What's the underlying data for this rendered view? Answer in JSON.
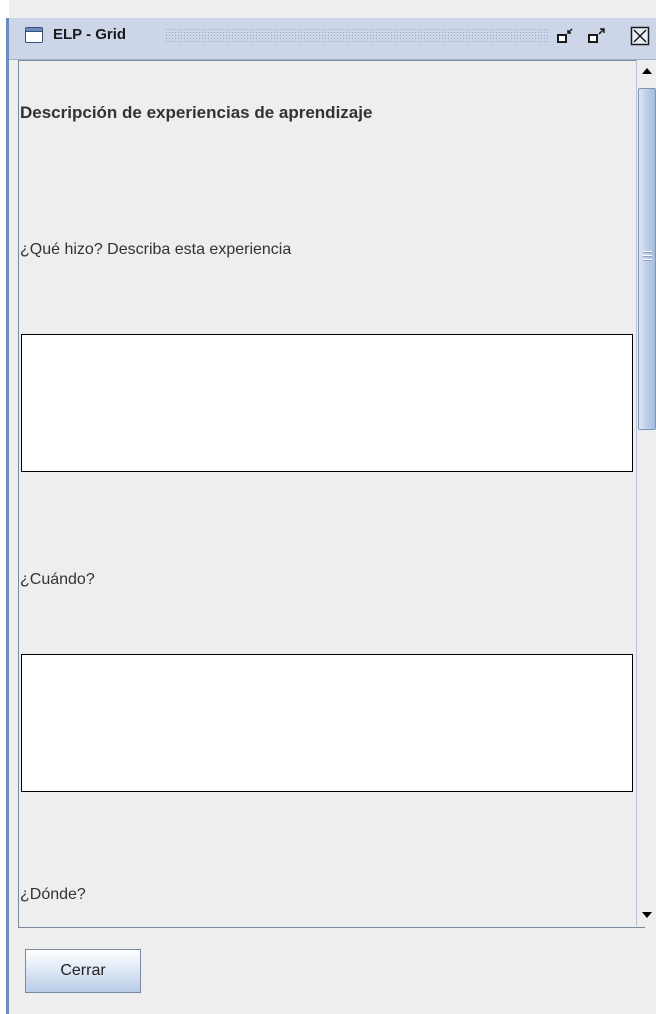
{
  "window": {
    "title": "ELP - Grid",
    "icons": [
      "window-icon",
      "iconify-icon",
      "maximize-icon",
      "close-icon"
    ]
  },
  "form": {
    "heading": "Descripción de experiencias de aprendizaje",
    "q1_label": "¿Qué hizo? Describa esta experiencia",
    "q1_value": "",
    "q2_label": "¿Cuándo?",
    "q2_value": "",
    "q3_label": "¿Dónde?"
  },
  "footer": {
    "close_label": "Cerrar"
  },
  "colors": {
    "titlebar": "#ccd6e8",
    "panel": "#eeeeee",
    "accent": "#6b8cbf"
  }
}
